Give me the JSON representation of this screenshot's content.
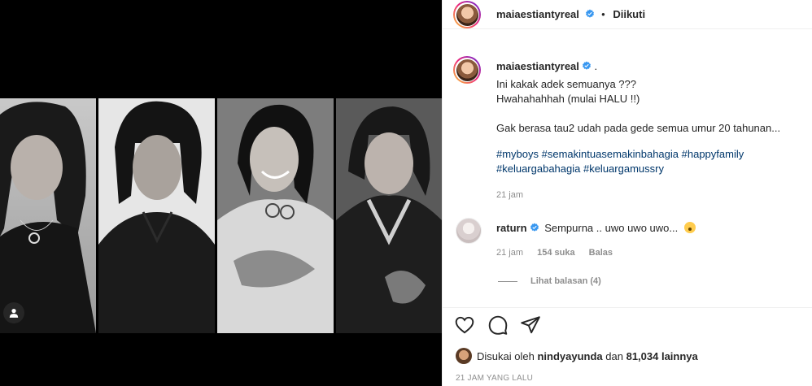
{
  "post": {
    "username": "maiaestiantyreal",
    "follow_status": "Diikuti",
    "caption_suffix": ".",
    "caption_lines": [
      "Ini kakak adek semuanya ???",
      "Hwahahahhah (mulai HALU !!)",
      "Gak berasa tau2 udah pada gede semua umur 20 tahunan..."
    ],
    "hashtags_line1": "#myboys #semakintuasemakinbahagia #happyfamily",
    "hashtags_line2": "#keluargabahagia #keluargamussry",
    "caption_time": "21 jam"
  },
  "comment": {
    "username": "raturn",
    "text": "Sempurna .. uwo uwo uwo...",
    "time": "21 jam",
    "likes": "154 suka",
    "reply_label": "Balas",
    "view_replies": "Lihat balasan (4)"
  },
  "likes": {
    "prefix": "Disukai oleh",
    "user": "nindyayunda",
    "conj": "dan",
    "others": "81,034 lainnya"
  },
  "timestamp": "21 JAM YANG LALU",
  "icons": {
    "verified": "verified-badge-icon",
    "heart": "heart-icon",
    "comment": "comment-icon",
    "share": "share-icon",
    "tag": "user-tag-icon"
  },
  "colors": {
    "verified_blue": "#3897f0",
    "hashtag": "#00376b",
    "muted": "#8e8e8e"
  }
}
